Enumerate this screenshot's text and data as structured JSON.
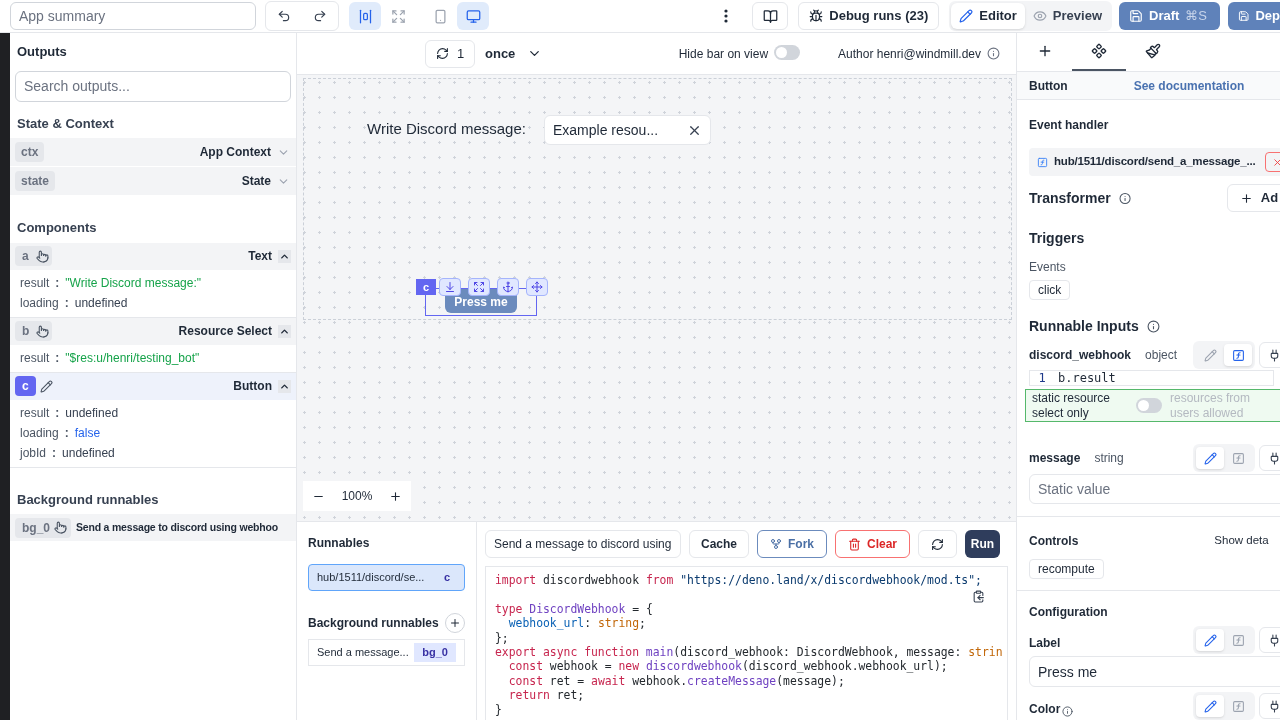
{
  "topbar": {
    "summary_placeholder": "App summary",
    "history": [
      {
        "kind": "undo"
      },
      {
        "kind": "redo"
      }
    ],
    "layout_toggles": [
      {
        "kind": "center",
        "selected": true
      },
      {
        "kind": "fullscreen",
        "selected": false
      }
    ],
    "device_toggles": [
      {
        "kind": "mobile",
        "selected": false
      },
      {
        "kind": "desktop",
        "selected": true
      }
    ],
    "debug_runs": {
      "label": "Debug runs",
      "count": "(23)"
    },
    "mode_tabs": [
      {
        "kind": "editor",
        "label": "Editor",
        "selected": true
      },
      {
        "kind": "preview",
        "label": "Preview",
        "selected": false
      }
    ],
    "draft": {
      "label": "Draft",
      "shortcut": "⌘S"
    },
    "deploy": {
      "label": "Dep"
    }
  },
  "outputs": {
    "title": "Outputs",
    "search_placeholder": "Search outputs...",
    "state_context": {
      "title": "State & Context",
      "items": [
        {
          "id": "ctx",
          "label": "App Context",
          "expanded": false
        },
        {
          "id": "state",
          "label": "State",
          "expanded": false
        }
      ]
    },
    "components": {
      "title": "Components",
      "items": [
        {
          "id": "a",
          "label": "Text",
          "selected": false,
          "expanded": true,
          "fields": [
            {
              "key": "result",
              "separator": ":",
              "value": "\"Write Discord message:\"",
              "kind": "string"
            },
            {
              "key": "loading",
              "separator": ":",
              "value": "undefined",
              "kind": "undefined"
            }
          ]
        },
        {
          "id": "b",
          "label": "Resource Select",
          "selected": false,
          "expanded": true,
          "fields": [
            {
              "key": "result",
              "separator": ":",
              "value": "\"$res:u/henri/testing_bot\"",
              "kind": "string"
            }
          ]
        },
        {
          "id": "c",
          "label": "Button",
          "selected": true,
          "expanded": true,
          "fields": [
            {
              "key": "result",
              "separator": ":",
              "value": "undefined",
              "kind": "undefined"
            },
            {
              "key": "loading",
              "separator": ":",
              "value": "false",
              "kind": "boolean"
            },
            {
              "key": "jobId",
              "separator": ":",
              "value": "undefined",
              "kind": "undefined"
            }
          ]
        }
      ]
    },
    "background": {
      "title": "Background runnables",
      "items": [
        {
          "id": "bg_0",
          "label": "Send a message to discord using webhoo"
        }
      ]
    }
  },
  "canvas_bar": {
    "refresh_count": "1",
    "refresh_mode": "once",
    "hide_bar": {
      "label": "Hide bar on view",
      "on": false
    },
    "author": "Author henri@windmill.dev"
  },
  "canvas": {
    "text": "Write Discord message:",
    "resource_select": {
      "value": "Example resou..."
    },
    "button": {
      "id": "c",
      "label": "Press me",
      "selected": true
    },
    "zoom": "100%"
  },
  "runnables": {
    "title": "Runnables",
    "items": [
      {
        "path": "hub/1511/discord/se...",
        "id": "c",
        "selected": true
      }
    ],
    "background_title": "Background runnables",
    "background_items": [
      {
        "label": "Send a message...",
        "id": "bg_0",
        "selected": false
      }
    ]
  },
  "editor": {
    "summary": "Send a message to discord using",
    "cache": "Cache",
    "fork": "Fork",
    "clear": "Clear",
    "run": "Run",
    "code": [
      {
        "kind": "code",
        "tokens": [
          {
            "text": "import",
            "kind": "keyword"
          },
          {
            "text": " discordwebhook ",
            "kind": "plain"
          },
          {
            "text": "from",
            "kind": "keyword"
          },
          {
            "text": " \"https://deno.land/x/discordwebhook/mod.ts\";",
            "kind": "string"
          }
        ]
      },
      {
        "kind": "blank"
      },
      {
        "kind": "code",
        "tokens": [
          {
            "text": "type",
            "kind": "keyword"
          },
          {
            "text": " DiscordWebhook",
            "kind": "type"
          },
          {
            "text": " = {",
            "kind": "plain"
          }
        ]
      },
      {
        "kind": "code",
        "tokens": [
          {
            "text": "  webhook_url",
            "kind": "prop"
          },
          {
            "text": ": ",
            "kind": "plain"
          },
          {
            "text": "string",
            "kind": "builtin"
          },
          {
            "text": ";",
            "kind": "plain"
          }
        ]
      },
      {
        "kind": "code",
        "tokens": [
          {
            "text": "};",
            "kind": "plain"
          }
        ]
      },
      {
        "kind": "code",
        "tokens": [
          {
            "text": "export async function",
            "kind": "keyword"
          },
          {
            "text": " main",
            "kind": "func"
          },
          {
            "text": "(discord_webhook: DiscordWebhook, message: ",
            "kind": "plain"
          },
          {
            "text": "strin",
            "kind": "builtin"
          }
        ]
      },
      {
        "kind": "code",
        "tokens": [
          {
            "text": "  const",
            "kind": "keyword"
          },
          {
            "text": " webhook = ",
            "kind": "plain"
          },
          {
            "text": "new",
            "kind": "keyword"
          },
          {
            "text": " discordwebhook",
            "kind": "func"
          },
          {
            "text": "(discord_webhook.webhook_url);",
            "kind": "plain"
          }
        ]
      },
      {
        "kind": "code",
        "tokens": [
          {
            "text": "  const",
            "kind": "keyword"
          },
          {
            "text": " ret = ",
            "kind": "plain"
          },
          {
            "text": "await",
            "kind": "keyword"
          },
          {
            "text": " webhook.",
            "kind": "plain"
          },
          {
            "text": "createMessage",
            "kind": "func"
          },
          {
            "text": "(message);",
            "kind": "plain"
          }
        ]
      },
      {
        "kind": "code",
        "tokens": [
          {
            "text": "  return",
            "kind": "keyword"
          },
          {
            "text": " ret;",
            "kind": "plain"
          }
        ]
      },
      {
        "kind": "code",
        "tokens": [
          {
            "text": "}",
            "kind": "plain"
          }
        ]
      }
    ]
  },
  "inspector": {
    "tabs": [
      {
        "kind": "add",
        "selected": false
      },
      {
        "kind": "component",
        "selected": true
      },
      {
        "kind": "style",
        "selected": false
      }
    ],
    "component": "Button",
    "docs_link": "See documentation",
    "event_handler": "Event handler",
    "script_path": "hub/1511/discord/send_a_message_...",
    "transformer": "Transformer",
    "add": "Ad",
    "triggers": "Triggers",
    "events_label": "Events",
    "events": [
      "click"
    ],
    "runnable_inputs": "Runnable Inputs",
    "inputs": [
      {
        "kind": "expression",
        "name": "discord_webhook",
        "type": "object",
        "evaluated": true,
        "line_number": "1",
        "code": "b.result",
        "note": {
          "left": "static resource select only",
          "right": "resources from users allowed",
          "on": false
        }
      },
      {
        "kind": "text",
        "name": "message",
        "type": "string",
        "evaluated": false,
        "placeholder": "Static value"
      }
    ],
    "controls": "Controls",
    "show_details": "Show deta",
    "control_items": [
      "recompute"
    ],
    "configuration": "Configuration",
    "config_fields": [
      {
        "kind": "text",
        "label": "Label",
        "evaluated": false,
        "value": "Press me"
      },
      {
        "kind": "color",
        "label": "Color",
        "evaluated": false
      }
    ]
  }
}
